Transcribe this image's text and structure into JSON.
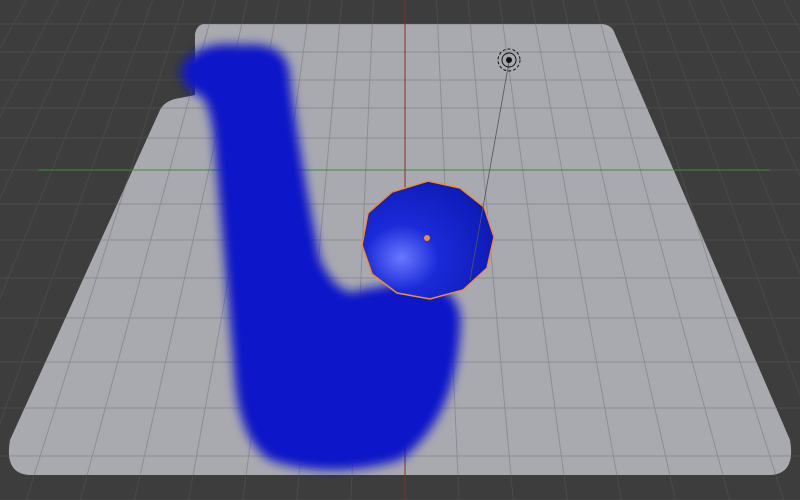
{
  "viewport": {
    "type": "3d-viewport",
    "colors": {
      "background": "#3d3d3d",
      "world_grid": "#4a4a4a",
      "plane": "#a9a9b0",
      "plane_grid": "#8d8d94",
      "paint": "#0a14c8",
      "sphere": "#1628d2",
      "selection_outline": "#f0902a",
      "x_axis": "#8a2a2a",
      "y_axis": "#3f8a3f"
    },
    "objects": [
      {
        "name": "plane",
        "icon": "plane-mesh"
      },
      {
        "name": "paint-stroke",
        "icon": "paint-stroke"
      },
      {
        "name": "sphere",
        "icon": "sphere-mesh",
        "selected": true
      },
      {
        "name": "lamp",
        "icon": "lamp-icon"
      }
    ]
  }
}
